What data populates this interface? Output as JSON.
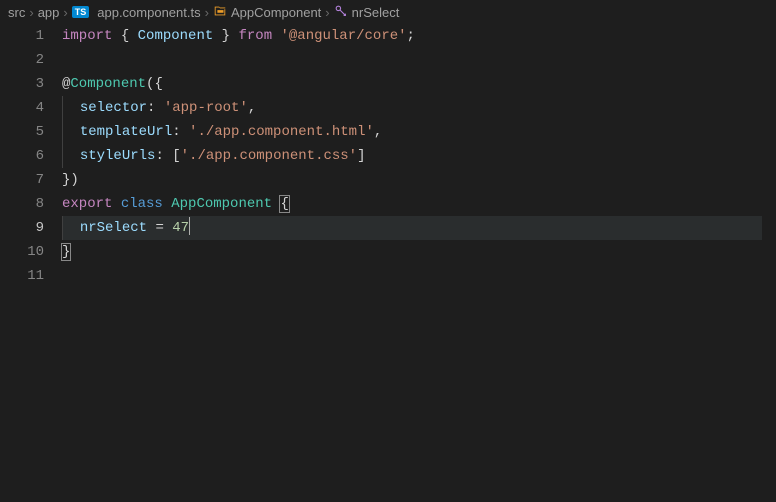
{
  "breadcrumb": {
    "items": [
      {
        "label": "src"
      },
      {
        "label": "app"
      },
      {
        "label": "app.component.ts",
        "badge": "TS"
      },
      {
        "label": "AppComponent",
        "kind": "class"
      },
      {
        "label": "nrSelect",
        "kind": "method"
      }
    ]
  },
  "editor": {
    "active_line": 9,
    "line_count": 11,
    "lines": {
      "l1": {
        "kw_import": "import",
        "brace_l": "{",
        "ident": "Component",
        "brace_r": "}",
        "kw_from": "from",
        "str": "'@angular/core'",
        "semi": ";"
      },
      "l3": {
        "at": "@",
        "decor": "Component",
        "paren_l": "(",
        "brace_l": "{"
      },
      "l4": {
        "prop": "selector",
        "colon": ":",
        "str": "'app-root'",
        "comma": ","
      },
      "l5": {
        "prop": "templateUrl",
        "colon": ":",
        "str": "'./app.component.html'",
        "comma": ","
      },
      "l6": {
        "prop": "styleUrls",
        "colon": ":",
        "brack_l": "[",
        "str": "'./app.component.css'",
        "brack_r": "]"
      },
      "l7": {
        "brace_r": "}",
        "paren_r": ")"
      },
      "l8": {
        "kw_export": "export",
        "kw_class": "class",
        "type": "AppComponent",
        "brace_l": "{"
      },
      "l9": {
        "ident": "nrSelect",
        "eq": "=",
        "num": "47"
      },
      "l10": {
        "brace_r": "}"
      }
    }
  }
}
